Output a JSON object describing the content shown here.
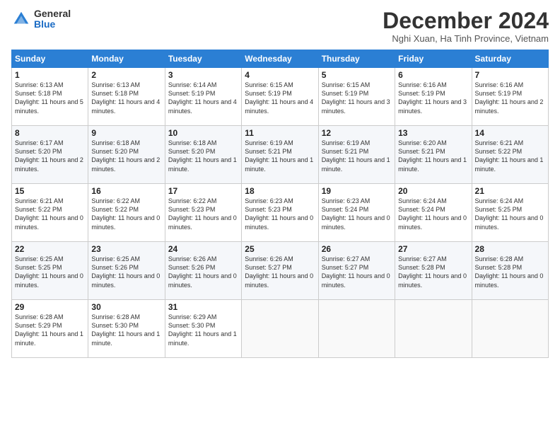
{
  "logo": {
    "general": "General",
    "blue": "Blue"
  },
  "header": {
    "month_title": "December 2024",
    "subtitle": "Nghi Xuan, Ha Tinh Province, Vietnam"
  },
  "weekdays": [
    "Sunday",
    "Monday",
    "Tuesday",
    "Wednesday",
    "Thursday",
    "Friday",
    "Saturday"
  ],
  "weeks": [
    [
      {
        "day": "1",
        "sunrise": "6:13 AM",
        "sunset": "5:18 PM",
        "daylight": "11 hours and 5 minutes."
      },
      {
        "day": "2",
        "sunrise": "6:13 AM",
        "sunset": "5:18 PM",
        "daylight": "11 hours and 4 minutes."
      },
      {
        "day": "3",
        "sunrise": "6:14 AM",
        "sunset": "5:19 PM",
        "daylight": "11 hours and 4 minutes."
      },
      {
        "day": "4",
        "sunrise": "6:15 AM",
        "sunset": "5:19 PM",
        "daylight": "11 hours and 4 minutes."
      },
      {
        "day": "5",
        "sunrise": "6:15 AM",
        "sunset": "5:19 PM",
        "daylight": "11 hours and 3 minutes."
      },
      {
        "day": "6",
        "sunrise": "6:16 AM",
        "sunset": "5:19 PM",
        "daylight": "11 hours and 3 minutes."
      },
      {
        "day": "7",
        "sunrise": "6:16 AM",
        "sunset": "5:19 PM",
        "daylight": "11 hours and 2 minutes."
      }
    ],
    [
      {
        "day": "8",
        "sunrise": "6:17 AM",
        "sunset": "5:20 PM",
        "daylight": "11 hours and 2 minutes."
      },
      {
        "day": "9",
        "sunrise": "6:18 AM",
        "sunset": "5:20 PM",
        "daylight": "11 hours and 2 minutes."
      },
      {
        "day": "10",
        "sunrise": "6:18 AM",
        "sunset": "5:20 PM",
        "daylight": "11 hours and 1 minute."
      },
      {
        "day": "11",
        "sunrise": "6:19 AM",
        "sunset": "5:21 PM",
        "daylight": "11 hours and 1 minute."
      },
      {
        "day": "12",
        "sunrise": "6:19 AM",
        "sunset": "5:21 PM",
        "daylight": "11 hours and 1 minute."
      },
      {
        "day": "13",
        "sunrise": "6:20 AM",
        "sunset": "5:21 PM",
        "daylight": "11 hours and 1 minute."
      },
      {
        "day": "14",
        "sunrise": "6:21 AM",
        "sunset": "5:22 PM",
        "daylight": "11 hours and 1 minute."
      }
    ],
    [
      {
        "day": "15",
        "sunrise": "6:21 AM",
        "sunset": "5:22 PM",
        "daylight": "11 hours and 0 minutes."
      },
      {
        "day": "16",
        "sunrise": "6:22 AM",
        "sunset": "5:22 PM",
        "daylight": "11 hours and 0 minutes."
      },
      {
        "day": "17",
        "sunrise": "6:22 AM",
        "sunset": "5:23 PM",
        "daylight": "11 hours and 0 minutes."
      },
      {
        "day": "18",
        "sunrise": "6:23 AM",
        "sunset": "5:23 PM",
        "daylight": "11 hours and 0 minutes."
      },
      {
        "day": "19",
        "sunrise": "6:23 AM",
        "sunset": "5:24 PM",
        "daylight": "11 hours and 0 minutes."
      },
      {
        "day": "20",
        "sunrise": "6:24 AM",
        "sunset": "5:24 PM",
        "daylight": "11 hours and 0 minutes."
      },
      {
        "day": "21",
        "sunrise": "6:24 AM",
        "sunset": "5:25 PM",
        "daylight": "11 hours and 0 minutes."
      }
    ],
    [
      {
        "day": "22",
        "sunrise": "6:25 AM",
        "sunset": "5:25 PM",
        "daylight": "11 hours and 0 minutes."
      },
      {
        "day": "23",
        "sunrise": "6:25 AM",
        "sunset": "5:26 PM",
        "daylight": "11 hours and 0 minutes."
      },
      {
        "day": "24",
        "sunrise": "6:26 AM",
        "sunset": "5:26 PM",
        "daylight": "11 hours and 0 minutes."
      },
      {
        "day": "25",
        "sunrise": "6:26 AM",
        "sunset": "5:27 PM",
        "daylight": "11 hours and 0 minutes."
      },
      {
        "day": "26",
        "sunrise": "6:27 AM",
        "sunset": "5:27 PM",
        "daylight": "11 hours and 0 minutes."
      },
      {
        "day": "27",
        "sunrise": "6:27 AM",
        "sunset": "5:28 PM",
        "daylight": "11 hours and 0 minutes."
      },
      {
        "day": "28",
        "sunrise": "6:28 AM",
        "sunset": "5:28 PM",
        "daylight": "11 hours and 0 minutes."
      }
    ],
    [
      {
        "day": "29",
        "sunrise": "6:28 AM",
        "sunset": "5:29 PM",
        "daylight": "11 hours and 1 minute."
      },
      {
        "day": "30",
        "sunrise": "6:28 AM",
        "sunset": "5:30 PM",
        "daylight": "11 hours and 1 minute."
      },
      {
        "day": "31",
        "sunrise": "6:29 AM",
        "sunset": "5:30 PM",
        "daylight": "11 hours and 1 minute."
      },
      null,
      null,
      null,
      null
    ]
  ]
}
